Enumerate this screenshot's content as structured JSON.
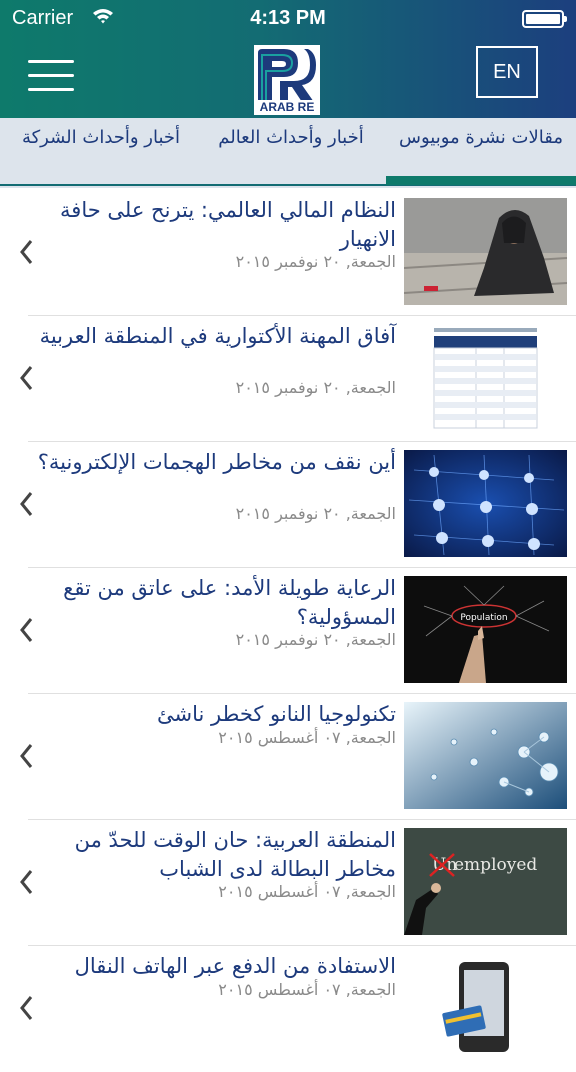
{
  "status_bar": {
    "carrier": "Carrier",
    "time": "4:13 PM"
  },
  "header": {
    "logo_text": "ARAB RE",
    "lang_button": "EN"
  },
  "tabs": [
    {
      "label": "مقالات نشرة موبيوس",
      "active": true
    },
    {
      "label": "أخبار وأحداث العالم",
      "active": false
    },
    {
      "label": "أخبار وأحداث الشركة",
      "active": false
    }
  ],
  "articles": [
    {
      "title": "النظام المالي العالمي: يترنح على حافة الانهيار",
      "date": "الجمعة, ٢٠ نوفمبر ٢٠١٥"
    },
    {
      "title": "آفاق المهنة الأكتوارية في المنطقة العربية",
      "date": "الجمعة, ٢٠ نوفمبر ٢٠١٥"
    },
    {
      "title": "أين نقف من مخاطر الهجمات الإلكترونية؟",
      "date": "الجمعة, ٢٠ نوفمبر ٢٠١٥"
    },
    {
      "title": "الرعاية طويلة الأمد: على عاتق من تقع المسؤولية؟",
      "date": "الجمعة, ٢٠ نوفمبر ٢٠١٥"
    },
    {
      "title": "تكنولوجيا النانو كخطر ناشئ",
      "date": "الجمعة, ٠٧ أغسطس ٢٠١٥"
    },
    {
      "title": "المنطقة العربية: حان الوقت للحدّ من مخاطر البطالة لدى الشباب",
      "date": "الجمعة, ٠٧ أغسطس ٢٠١٥"
    },
    {
      "title": "الاستفادة من الدفع عبر الهاتف النقال",
      "date": "الجمعة, ٠٧ أغسطس ٢٠١٥"
    }
  ],
  "thumb_texts": {
    "population": "Population",
    "employed": "employed",
    "un": "Un"
  },
  "colors": {
    "brand_navy": "#1d3a7c",
    "brand_teal": "#0e7a6b",
    "tab_bg": "#dde4ec"
  }
}
